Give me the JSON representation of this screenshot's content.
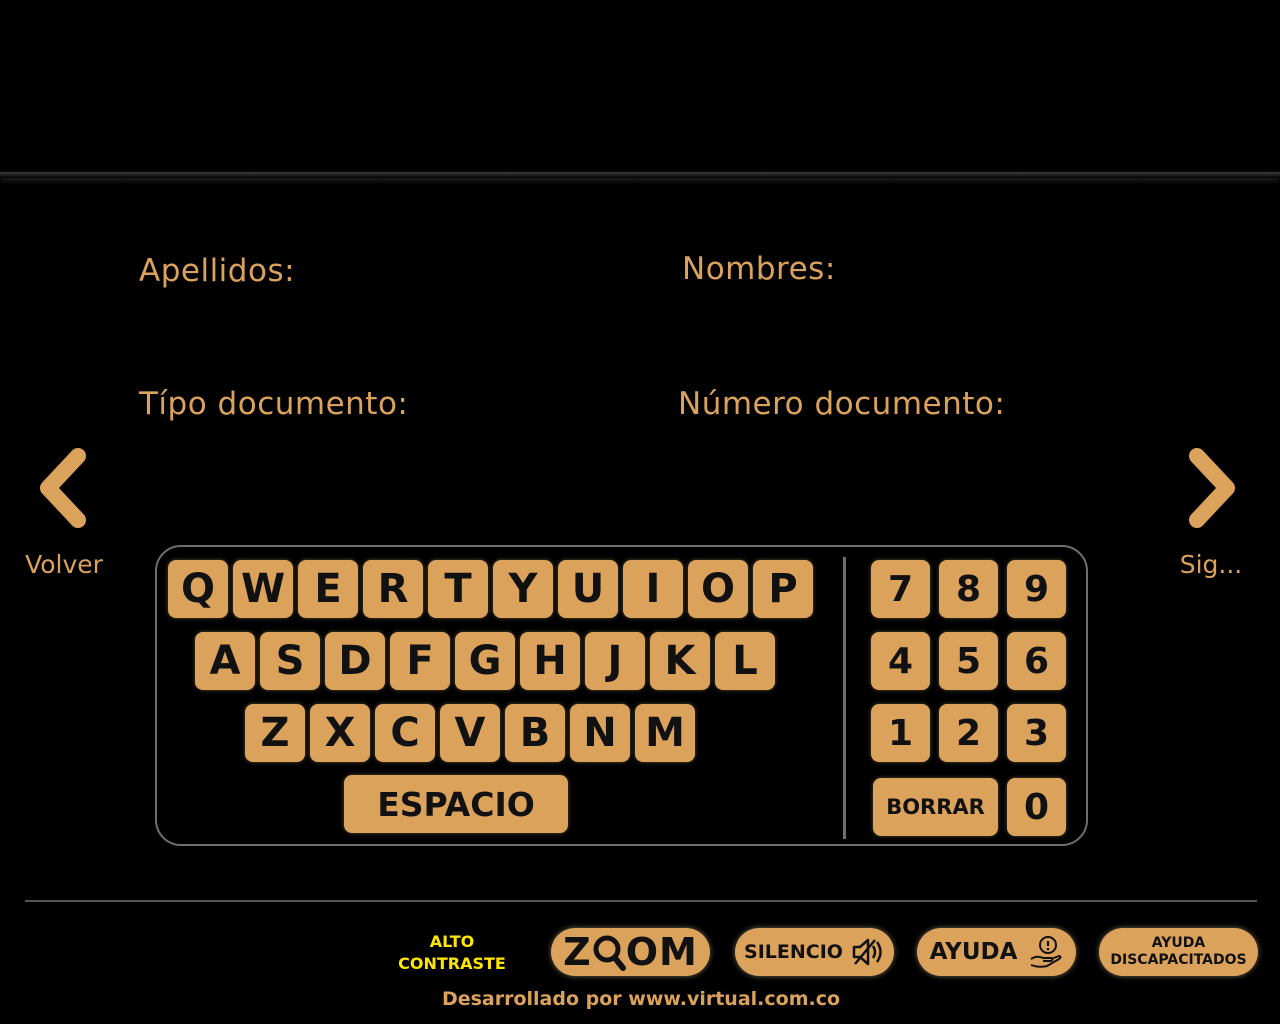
{
  "colors": {
    "accent": "#dba25c",
    "background": "#000000",
    "contrast_text": "#ffe600",
    "border": "#6e6e6e"
  },
  "form": {
    "apellidos_label": "Apellidos:",
    "nombres_label": "Nombres:",
    "tipo_documento_label": "Típo documento:",
    "numero_documento_label": "Número documento:"
  },
  "nav": {
    "back_label": "Volver",
    "back_icon": "chevron-left-icon",
    "next_label": "Sig...",
    "next_icon": "chevron-right-icon"
  },
  "keyboard": {
    "row1": [
      "Q",
      "W",
      "E",
      "R",
      "T",
      "Y",
      "U",
      "I",
      "O",
      "P"
    ],
    "row2": [
      "A",
      "S",
      "D",
      "F",
      "G",
      "H",
      "J",
      "K",
      "L"
    ],
    "row3": [
      "Z",
      "X",
      "C",
      "V",
      "B",
      "N",
      "M"
    ],
    "space_label": "ESPACIO",
    "numpad": [
      [
        "7",
        "8",
        "9"
      ],
      [
        "4",
        "5",
        "6"
      ],
      [
        "1",
        "2",
        "3"
      ]
    ],
    "borrar_label": "BORRAR",
    "zero": "0"
  },
  "footer": {
    "contrast_line1": "ALTO",
    "contrast_line2": "CONTRASTE",
    "zoom_z": "Z",
    "zoom_rest": "OM",
    "silencio_label": "SILENCIO",
    "silencio_icon": "speaker-muted-icon",
    "ayuda_label": "AYUDA",
    "ayuda_icon": "help-hand-icon",
    "disc_line1": "AYUDA",
    "disc_line2": "DISCAPACITADOS",
    "credits": "Desarrollado por www.virtual.com.co"
  }
}
